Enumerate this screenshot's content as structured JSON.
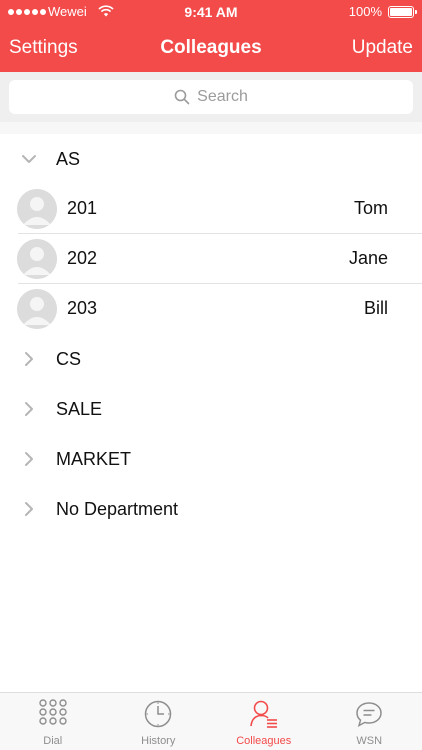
{
  "status_bar": {
    "carrier": "Wewei",
    "time": "9:41 AM",
    "battery": "100%"
  },
  "nav": {
    "left": "Settings",
    "title": "Colleagues",
    "right": "Update"
  },
  "search": {
    "placeholder": "Search"
  },
  "departments": [
    {
      "name": "AS",
      "expanded": true,
      "members": [
        {
          "ext": "201",
          "name": "Tom"
        },
        {
          "ext": "202",
          "name": "Jane"
        },
        {
          "ext": "203",
          "name": "Bill"
        }
      ]
    },
    {
      "name": "CS",
      "expanded": false
    },
    {
      "name": "SALE",
      "expanded": false
    },
    {
      "name": "MARKET",
      "expanded": false
    },
    {
      "name": "No Department",
      "expanded": false
    }
  ],
  "tabs": [
    {
      "label": "Dial",
      "icon": "dialpad-icon",
      "active": false
    },
    {
      "label": "History",
      "icon": "clock-icon",
      "active": false
    },
    {
      "label": "Colleagues",
      "icon": "contacts-icon",
      "active": true
    },
    {
      "label": "WSN",
      "icon": "chat-bubble-icon",
      "active": false
    }
  ],
  "colors": {
    "accent": "#f34a4a",
    "inactive_tab": "#8e8e8e"
  }
}
